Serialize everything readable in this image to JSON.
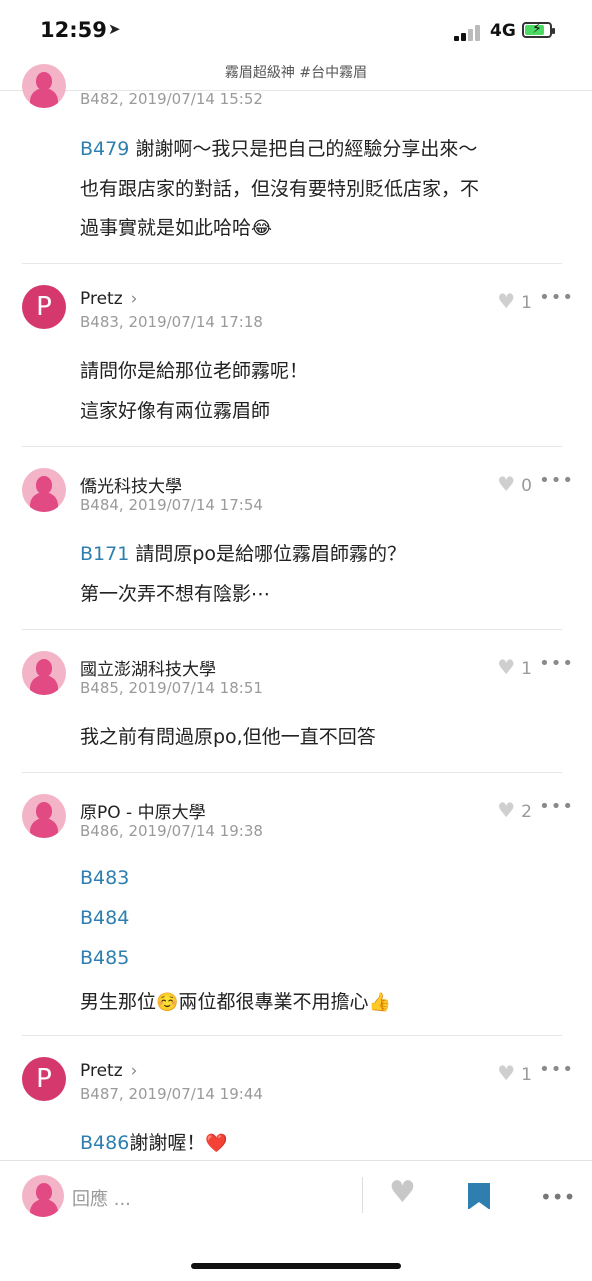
{
  "status": {
    "time": "12:59",
    "network": "4G"
  },
  "topbar": {
    "title": "霧眉超級神 #台中霧眉"
  },
  "comments": [
    {
      "meta": "B482, 2019/07/14 15:52",
      "line1_ref": "B479",
      "line1": " 謝謝啊～我只是把自己的經驗分享出來～",
      "line2": "也有跟店家的對話，但沒有要特別貶低店家，不",
      "line3": "過事實就是如此哈哈",
      "emoji": "😂"
    },
    {
      "author": "Pretz",
      "chevron": "›",
      "meta": "B483, 2019/07/14 17:18",
      "likes": "1",
      "line1": "請問你是給那位老師霧呢！",
      "line2": "這家好像有兩位霧眉師"
    },
    {
      "author": "僑光科技大學",
      "meta": "B484, 2019/07/14 17:54",
      "likes": "0",
      "line1_ref": "B171",
      "line1": " 請問原po是給哪位霧眉師霧的？",
      "line2": "第一次弄不想有陰影⋯"
    },
    {
      "author": "國立澎湖科技大學",
      "meta": "B485, 2019/07/14 18:51",
      "likes": "1",
      "line1": "我之前有問過原po,但他一直不回答"
    },
    {
      "author": "原PO - 中原大學",
      "meta": "B486, 2019/07/14 19:38",
      "likes": "2",
      "ref1": "B483",
      "ref2": "B484",
      "ref3": "B485",
      "line4a": "男生那位",
      "emoji1": "☺️",
      "line4b": "兩位都很專業不用擔心",
      "emoji2": "👍"
    },
    {
      "author": "Pretz",
      "chevron": "›",
      "meta": "B487, 2019/07/14 19:44",
      "likes": "1",
      "line1_ref": "B486",
      "line1": "謝謝喔！",
      "emoji": "❤️"
    }
  ],
  "bottombar": {
    "reply_placeholder": "回應 ..."
  },
  "avatar_letter": "P",
  "icons": {
    "heart": "heart-icon",
    "more": "more-icon",
    "bookmark": "bookmark-icon"
  },
  "colors": {
    "link": "#2e7fb0",
    "pretz_avatar": "#d4386c",
    "female_avatar": "#e24a83"
  }
}
